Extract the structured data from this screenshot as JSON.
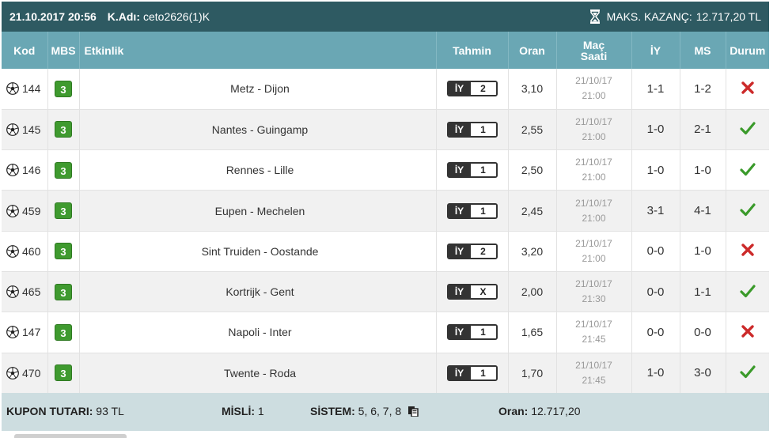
{
  "header": {
    "datetime": "21.10.2017 20:56",
    "user_label": "K.Adı:",
    "username": "ceto2626(1)K",
    "max_label": "MAKS. KAZANÇ:",
    "max_value": "12.717,20 TL",
    "icon": "hourglass-icon"
  },
  "columns": {
    "kod": "Kod",
    "mbs": "MBS",
    "etkinlik": "Etkinlik",
    "tahmin": "Tahmin",
    "oran": "Oran",
    "mac_saati_1": "Maç",
    "mac_saati_2": "Saati",
    "iy": "İY",
    "ms": "MS",
    "durum": "Durum"
  },
  "rows": [
    {
      "kod": "144",
      "mbs": "3",
      "event": "Metz - Dijon",
      "bet_type": "İY",
      "bet_value": "2",
      "odds": "3,10",
      "date": "21/10/17",
      "time": "21:00",
      "ht": "1-1",
      "ft": "1-2",
      "status": "lost"
    },
    {
      "kod": "145",
      "mbs": "3",
      "event": "Nantes - Guingamp",
      "bet_type": "İY",
      "bet_value": "1",
      "odds": "2,55",
      "date": "21/10/17",
      "time": "21:00",
      "ht": "1-0",
      "ft": "2-1",
      "status": "won"
    },
    {
      "kod": "146",
      "mbs": "3",
      "event": "Rennes - Lille",
      "bet_type": "İY",
      "bet_value": "1",
      "odds": "2,50",
      "date": "21/10/17",
      "time": "21:00",
      "ht": "1-0",
      "ft": "1-0",
      "status": "won"
    },
    {
      "kod": "459",
      "mbs": "3",
      "event": "Eupen - Mechelen",
      "bet_type": "İY",
      "bet_value": "1",
      "odds": "2,45",
      "date": "21/10/17",
      "time": "21:00",
      "ht": "3-1",
      "ft": "4-1",
      "status": "won"
    },
    {
      "kod": "460",
      "mbs": "3",
      "event": "Sint Truiden - Oostande",
      "bet_type": "İY",
      "bet_value": "2",
      "odds": "3,20",
      "date": "21/10/17",
      "time": "21:00",
      "ht": "0-0",
      "ft": "1-0",
      "status": "lost"
    },
    {
      "kod": "465",
      "mbs": "3",
      "event": "Kortrijk - Gent",
      "bet_type": "İY",
      "bet_value": "X",
      "odds": "2,00",
      "date": "21/10/17",
      "time": "21:30",
      "ht": "0-0",
      "ft": "1-1",
      "status": "won"
    },
    {
      "kod": "147",
      "mbs": "3",
      "event": "Napoli - Inter",
      "bet_type": "İY",
      "bet_value": "1",
      "odds": "1,65",
      "date": "21/10/17",
      "time": "21:45",
      "ht": "0-0",
      "ft": "0-0",
      "status": "lost"
    },
    {
      "kod": "470",
      "mbs": "3",
      "event": "Twente - Roda",
      "bet_type": "İY",
      "bet_value": "1",
      "odds": "1,70",
      "date": "21/10/17",
      "time": "21:45",
      "ht": "1-0",
      "ft": "3-0",
      "status": "won"
    }
  ],
  "footer": {
    "kupon_label": "KUPON TUTARI:",
    "kupon_value": "93 TL",
    "misli_label": "MİSLİ:",
    "misli_value": "1",
    "sistem_label": "SİSTEM:",
    "sistem_value": "5, 6, 7, 8",
    "oran_label": "Oran:",
    "oran_value": "12.717,20"
  },
  "colors": {
    "topbar": "#2e5a62",
    "table_header": "#6aa7b4",
    "mbs_badge": "#3f9a2f",
    "won": "#3a9a2a",
    "lost": "#cc2a2a",
    "footer": "#cddde0"
  }
}
